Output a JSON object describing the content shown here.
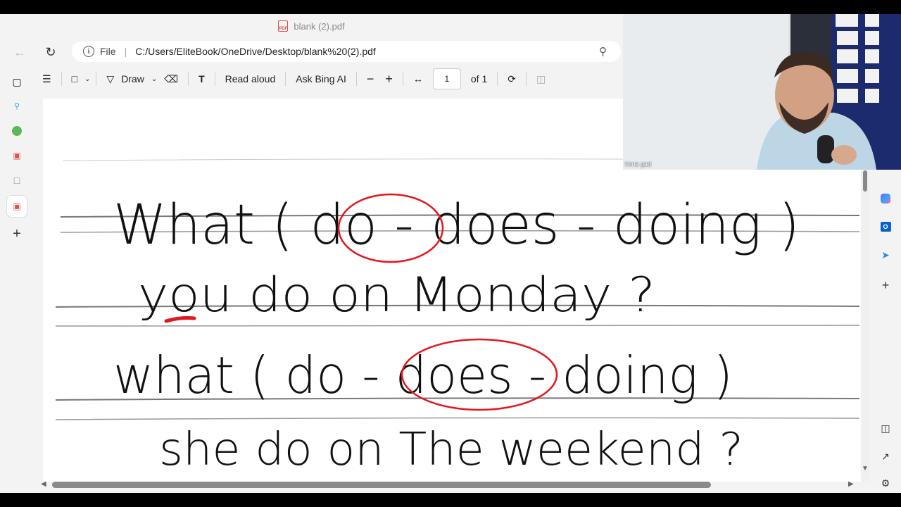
{
  "tab": {
    "title": "blank (2).pdf"
  },
  "address": {
    "scheme": "File",
    "separator": "|",
    "url": "C:/Users/EliteBook/OneDrive/Desktop/blank%20(2).pdf"
  },
  "toolbar": {
    "draw_label": "Draw",
    "read_aloud_label": "Read aloud",
    "ask_bing_label": "Ask Bing AI",
    "page_value": "1",
    "page_total": "of 1"
  },
  "document": {
    "line1": "What ( do - does - doing )",
    "line2": "you do on Monday ?",
    "line3": "what ( do - does - doing )",
    "line4": "she do on The weekend ?",
    "circled_answer_1": "do",
    "circled_answer_2": "does"
  },
  "webcam": {
    "participant_name": "hima gad"
  },
  "colors": {
    "annotation_red": "#e0191e",
    "ink": "#111111"
  }
}
